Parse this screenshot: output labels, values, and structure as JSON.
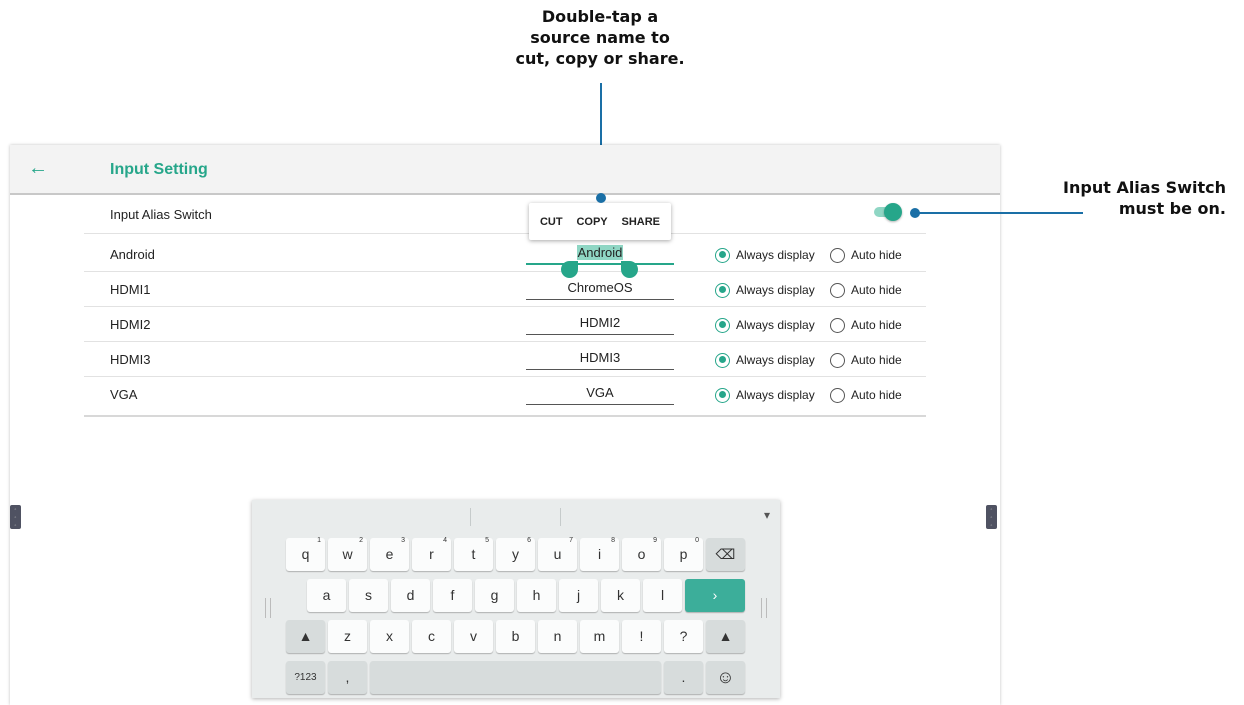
{
  "annotations": {
    "top_line1": "Double-tap a",
    "top_line2": "source name to",
    "top_line3": "cut, copy or share.",
    "right_line1": "Input Alias Switch",
    "right_line2": "must be on."
  },
  "appbar": {
    "back_icon": "←",
    "title": "Input Setting"
  },
  "alias_switch": {
    "label": "Input Alias Switch",
    "state": "on"
  },
  "context_menu": {
    "cut": "CUT",
    "copy": "COPY",
    "share": "SHARE"
  },
  "sources": [
    {
      "name": "Android",
      "alias": "Android",
      "always_display": "Always display",
      "auto_hide": "Auto hide",
      "selected": "always"
    },
    {
      "name": "HDMI1",
      "alias": "ChromeOS",
      "always_display": "Always display",
      "auto_hide": "Auto hide",
      "selected": "always"
    },
    {
      "name": "HDMI2",
      "alias": "HDMI2",
      "always_display": "Always display",
      "auto_hide": "Auto hide",
      "selected": "always"
    },
    {
      "name": "HDMI3",
      "alias": "HDMI3",
      "always_display": "Always display",
      "auto_hide": "Auto hide",
      "selected": "always"
    },
    {
      "name": "VGA",
      "alias": "VGA",
      "always_display": "Always display",
      "auto_hide": "Auto hide",
      "selected": "always"
    }
  ],
  "keyboard": {
    "row1": [
      "q",
      "w",
      "e",
      "r",
      "t",
      "y",
      "u",
      "i",
      "o",
      "p"
    ],
    "row1_hints": [
      "1",
      "2",
      "3",
      "4",
      "5",
      "6",
      "7",
      "8",
      "9",
      "0"
    ],
    "row2": [
      "a",
      "s",
      "d",
      "f",
      "g",
      "h",
      "j",
      "k",
      "l"
    ],
    "row3": [
      "z",
      "x",
      "c",
      "v",
      "b",
      "n",
      "m",
      "!",
      "?"
    ],
    "backspace_icon": "⌫",
    "enter_icon": "›",
    "shift_icon": "▲",
    "symbols_label": "?123",
    "comma": ",",
    "period": ".",
    "emoji_icon": "☺",
    "collapse_icon": "▾"
  },
  "colors": {
    "accent": "#26a68a",
    "callout_line": "#1a6fa6"
  }
}
